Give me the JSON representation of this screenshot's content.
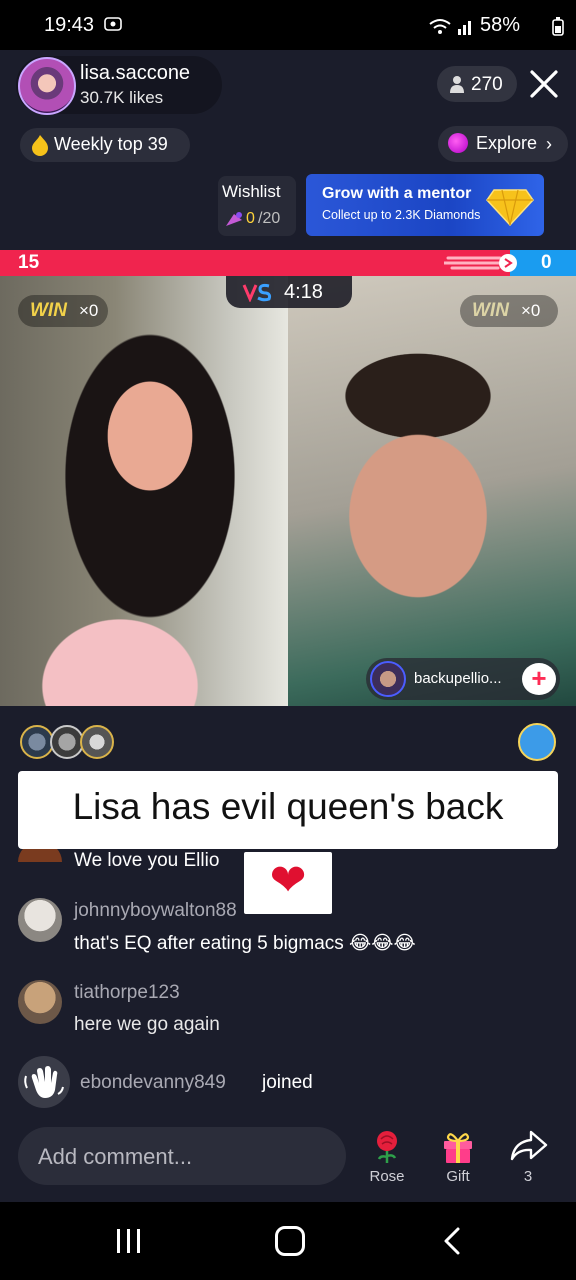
{
  "status_bar": {
    "time": "19:43",
    "battery": "58%"
  },
  "host": {
    "name": "lisa.saccone",
    "likes": "30.7K likes"
  },
  "viewers": {
    "count": "270"
  },
  "weekly": {
    "label": "Weekly top 39"
  },
  "explore": {
    "label": "Explore",
    "chevron": "›"
  },
  "wishlist": {
    "title": "Wishlist",
    "progress": "0",
    "total": "/20"
  },
  "mentor_banner": {
    "title": "Grow with a mentor",
    "subtitle": "Collect up to 2.3K Diamonds"
  },
  "battle": {
    "score_left": "15",
    "score_right": "0",
    "timer": "4:18",
    "win_left": {
      "word": "WIN",
      "count": "×0"
    },
    "win_right": {
      "word": "WIN",
      "count": "×0"
    },
    "guest_name": "backupellio...",
    "guest_follow": "+"
  },
  "caption": "Lisa has evil queen's back",
  "chat": [
    {
      "user": "",
      "text": "We love you Ellio"
    },
    {
      "user": "johnnyboywalton88",
      "text": "that's  EQ  after  eating  5 bigmacs 😂😂😂"
    },
    {
      "user": "tiathorpe123",
      "text": "here we go again"
    }
  ],
  "join": {
    "user": "ebondevanny849",
    "word": "joined"
  },
  "overlay_heart": "❤",
  "comment": {
    "placeholder": "Add comment..."
  },
  "actions": {
    "rose": "Rose",
    "gift": "Gift",
    "share_count": "3"
  },
  "colors": {
    "score_red": "#f0244e",
    "score_blue": "#1a9cf0",
    "accent_pink": "#fe2c55",
    "panel_bg": "#1b1d2b"
  },
  "icons": [
    "screen-record-icon",
    "wifi-icon",
    "signal-icon",
    "battery-icon",
    "person-icon",
    "close-icon",
    "flame-icon",
    "explore-icon",
    "chevron-right-icon",
    "diamond-icon",
    "vs-icon",
    "heart-icon",
    "rose-icon",
    "gift-icon",
    "share-icon",
    "wave-hand-icon"
  ]
}
